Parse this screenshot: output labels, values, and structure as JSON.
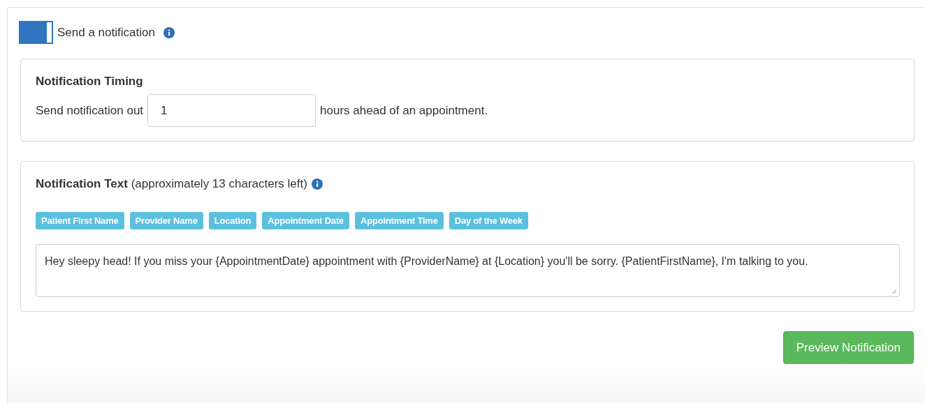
{
  "toggle": {
    "label": "Send a notification",
    "on": true
  },
  "timing": {
    "title": "Notification Timing",
    "prefix": "Send notification out",
    "value": "1",
    "suffix": "hours ahead of an appointment."
  },
  "text_section": {
    "heading": "**Notification Text** (approximately 13 characters left)",
    "tags": [
      "Patient First Name",
      "Provider Name",
      "Location",
      "Appointment Date",
      "Appointment Time",
      "Day of the Week"
    ],
    "message": "Hey sleepy head! If you miss your {AppointmentDate} appointment with {ProviderName} at {Location} you'll be sorry. {PatientFirstName}, I'm talking to you."
  },
  "buttons": [
    "Preview Notification"
  ]
}
